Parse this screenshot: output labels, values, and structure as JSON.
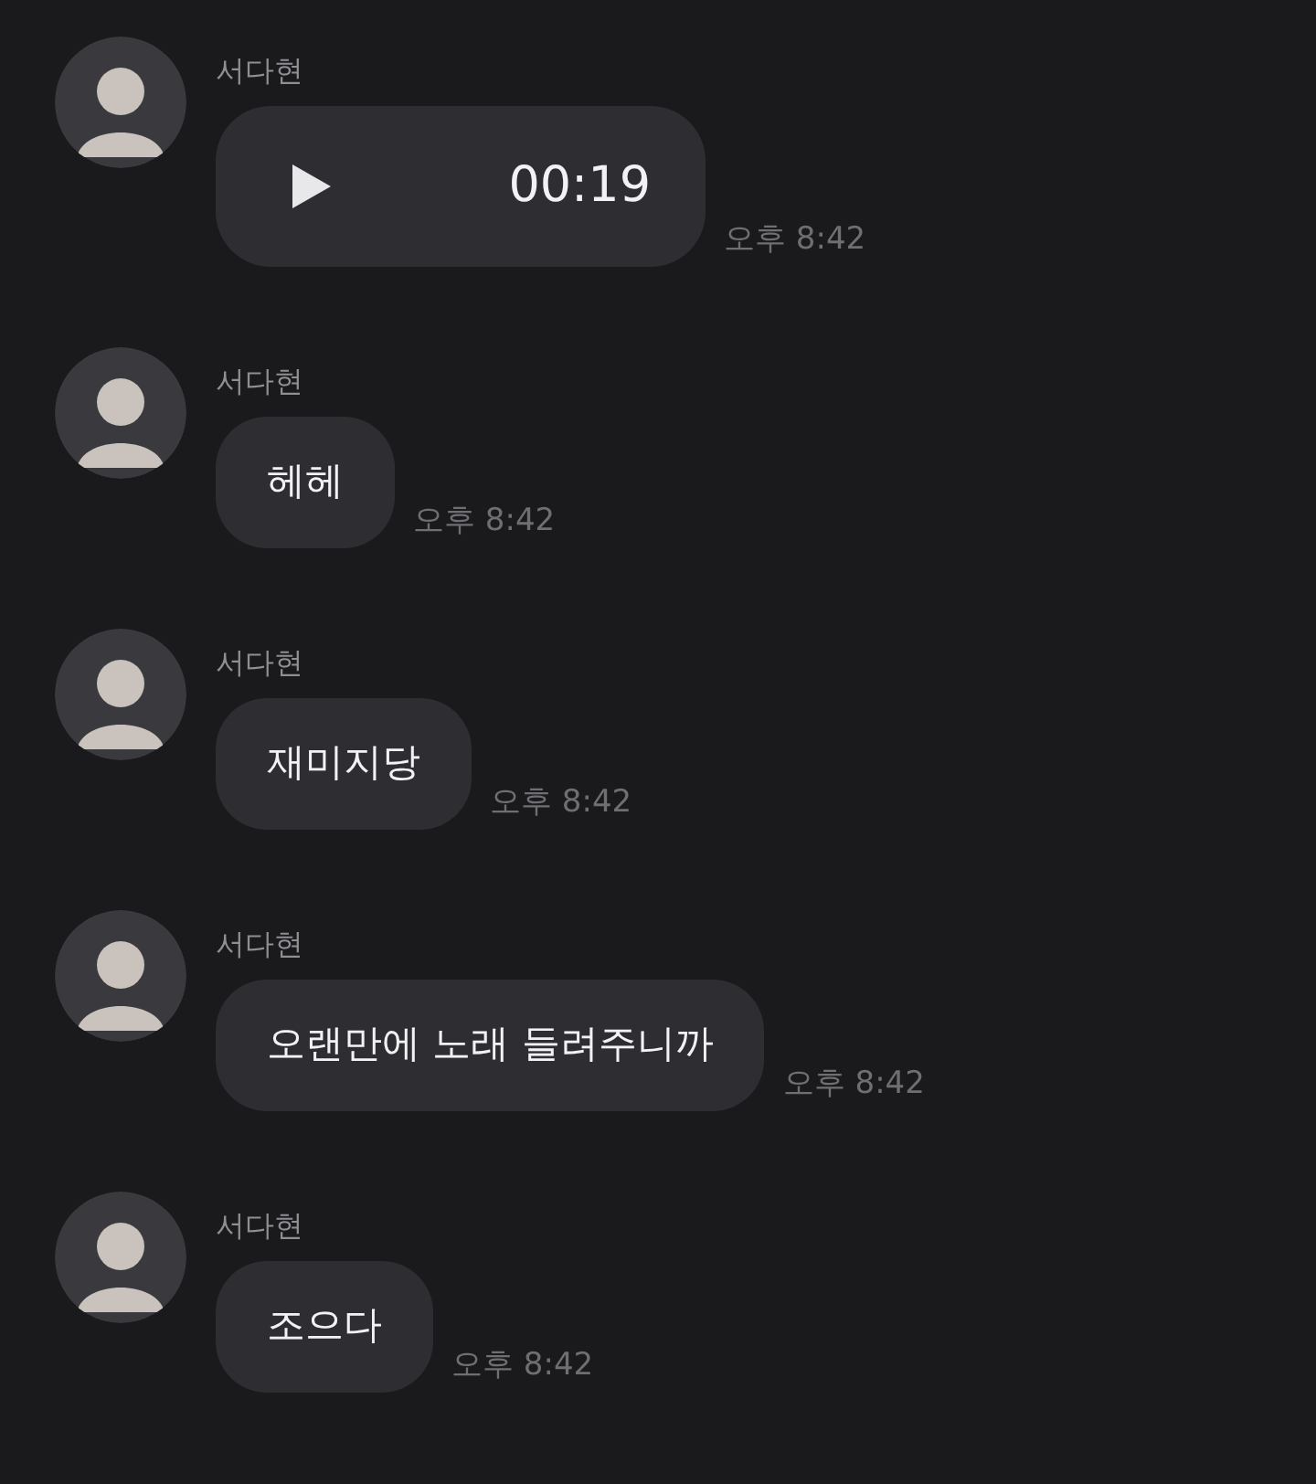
{
  "messages": [
    {
      "kind": "voice",
      "sender": "서다현",
      "duration": "00:19",
      "time": "오후 8:42"
    },
    {
      "kind": "text",
      "sender": "서다현",
      "text": "헤헤",
      "time": "오후 8:42"
    },
    {
      "kind": "text",
      "sender": "서다현",
      "text": "재미지당",
      "time": "오후 8:42"
    },
    {
      "kind": "text",
      "sender": "서다현",
      "text": "오랜만에 노래 들려주니까",
      "time": "오후 8:42"
    },
    {
      "kind": "text",
      "sender": "서다현",
      "text": "조으다",
      "time": "오후 8:42"
    }
  ]
}
